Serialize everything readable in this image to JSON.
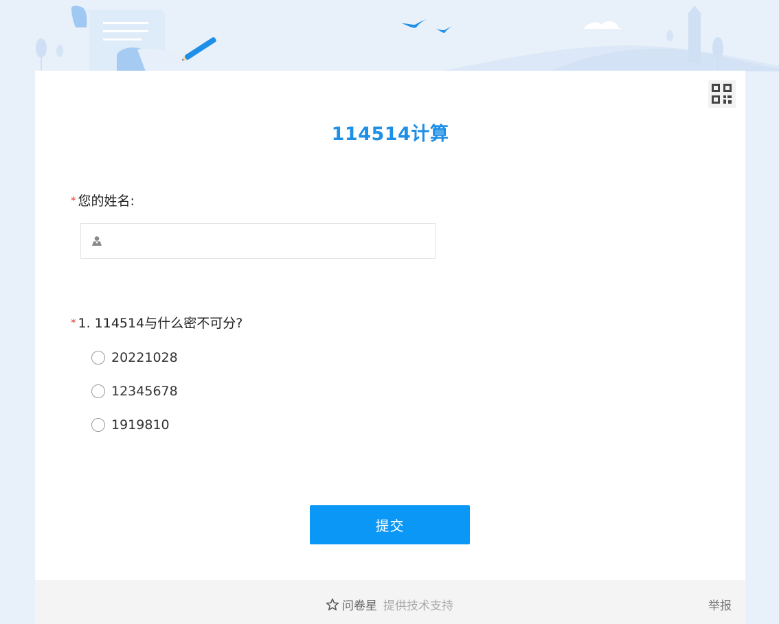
{
  "survey": {
    "title": "114514计算"
  },
  "name_question": {
    "required_mark": "*",
    "label": "您的姓名:",
    "value": "",
    "icon": "user-icon"
  },
  "question_1": {
    "required_mark": "*",
    "label": "1. 114514与什么密不可分?",
    "options": [
      {
        "label": "20221028",
        "selected": false
      },
      {
        "label": "12345678",
        "selected": false
      },
      {
        "label": "1919810",
        "selected": false
      }
    ]
  },
  "actions": {
    "submit_label": "提交"
  },
  "footer": {
    "brand": "问卷星",
    "support_text": "提供技术支持",
    "report_label": "举报"
  },
  "colors": {
    "accent": "#1e8fe6",
    "button": "#0b97f5",
    "required": "#e33333",
    "page_bg": "#e8f0fa"
  }
}
